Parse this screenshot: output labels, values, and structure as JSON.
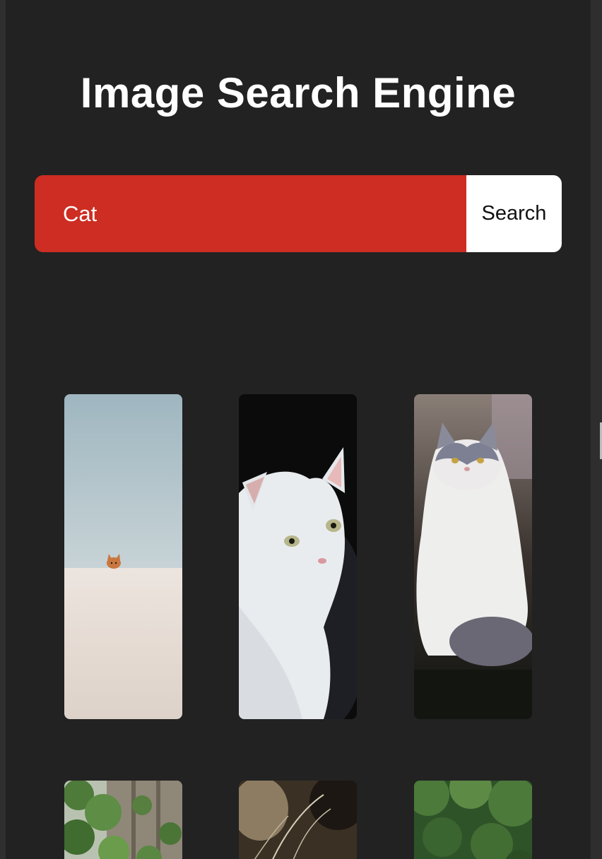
{
  "header": {
    "title": "Image Search Engine"
  },
  "search": {
    "value": "Cat",
    "button_label": "Search"
  },
  "results": [
    {
      "subject": "orange cat peeking over white wall"
    },
    {
      "subject": "white cat looking back"
    },
    {
      "subject": "fluffy grey and white cat sitting"
    },
    {
      "subject": "green plants by a fence"
    },
    {
      "subject": "dark fur close-up"
    },
    {
      "subject": "green trees"
    }
  ],
  "colors": {
    "background": "#222222",
    "search_field": "#cd2d22",
    "search_button": "#ffffff",
    "title_text": "#ffffff"
  }
}
